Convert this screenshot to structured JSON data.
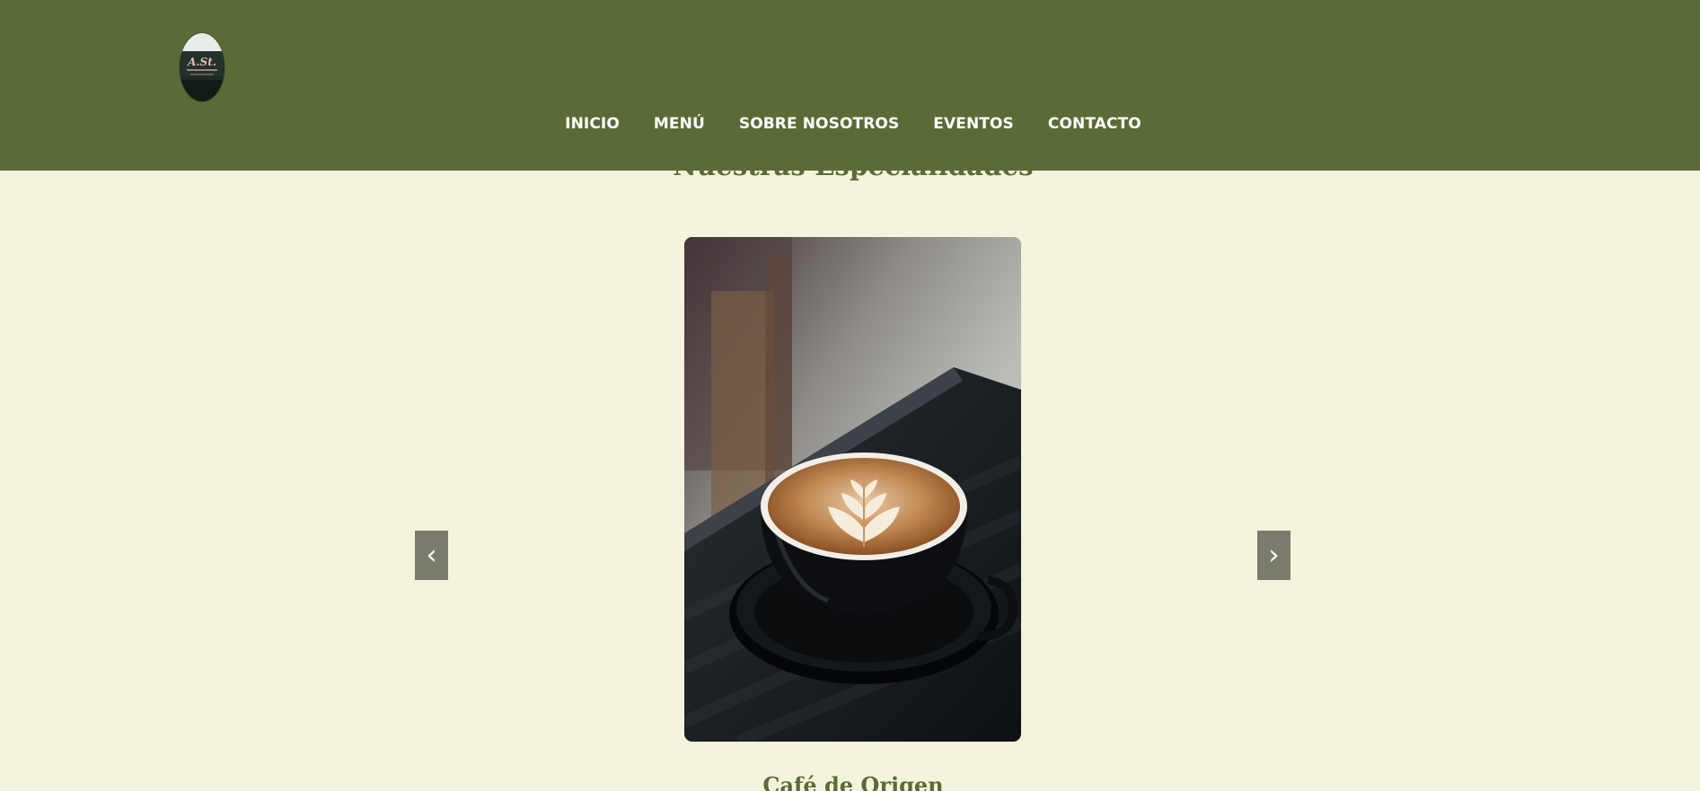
{
  "header": {
    "logo_text": "A.St.",
    "nav": [
      {
        "label": "INICIO"
      },
      {
        "label": "MENÚ"
      },
      {
        "label": "SOBRE NOSOTROS"
      },
      {
        "label": "EVENTOS"
      },
      {
        "label": "CONTACTO"
      }
    ]
  },
  "section": {
    "title": "Nuestras Especialidades"
  },
  "carousel": {
    "prev_label": "‹",
    "next_label": "›",
    "current_caption": "Café de Origen",
    "image_subject": "latte art coffee cup on black saucer"
  },
  "colors": {
    "header_bg": "#5a6b37",
    "page_bg": "#f4f4dc",
    "accent_text": "#5a6b37",
    "button_bg": "#7b7b6d"
  }
}
